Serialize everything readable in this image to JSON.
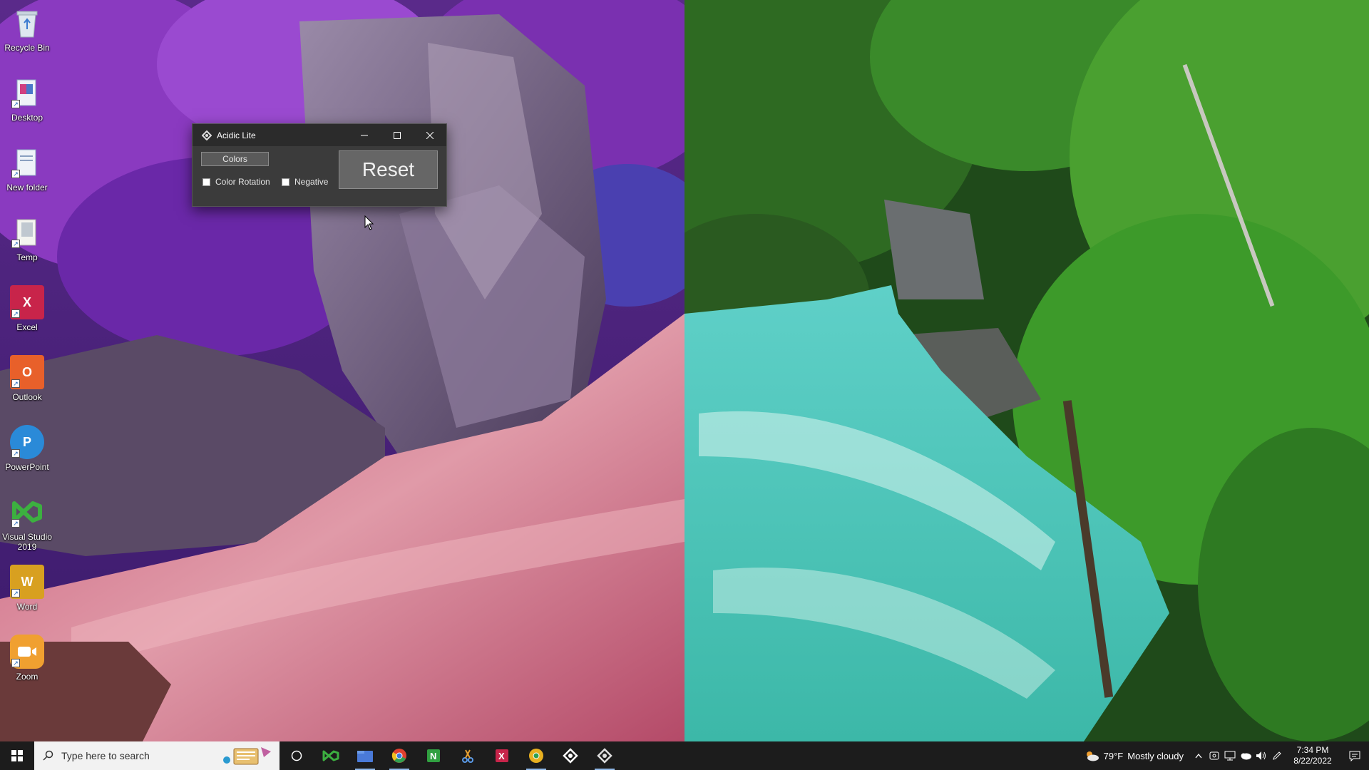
{
  "desktop": {
    "icons": [
      {
        "label": "Recycle Bin"
      },
      {
        "label": "Desktop"
      },
      {
        "label": "New folder"
      },
      {
        "label": "Temp"
      },
      {
        "label": "Excel"
      },
      {
        "label": "Outlook"
      },
      {
        "label": "PowerPoint"
      },
      {
        "label": "Visual Studio 2019"
      },
      {
        "label": "Word"
      },
      {
        "label": "Zoom"
      }
    ]
  },
  "window": {
    "title": "Acidic Lite",
    "colors_label": "Colors",
    "color_rotation_label": "Color Rotation",
    "color_rotation_checked": false,
    "negative_label": "Negative",
    "negative_checked": false,
    "reset_label": "Reset"
  },
  "taskbar": {
    "search_placeholder": "Type here to search",
    "apps": [
      "cortana",
      "visual-studio",
      "file-explorer",
      "chrome",
      "onenote",
      "snipping-tool",
      "excel-taskbar",
      "chrome-canary",
      "acidic-1",
      "acidic-2"
    ],
    "weather_temp": "79°F",
    "weather_desc": "Mostly cloudy",
    "time": "7:34 PM",
    "date": "8/22/2022"
  },
  "colors": {
    "taskbar_bg": "#1c1c1c",
    "window_bg": "#3b3b3b",
    "titlebar_bg": "#2b2b2b"
  }
}
